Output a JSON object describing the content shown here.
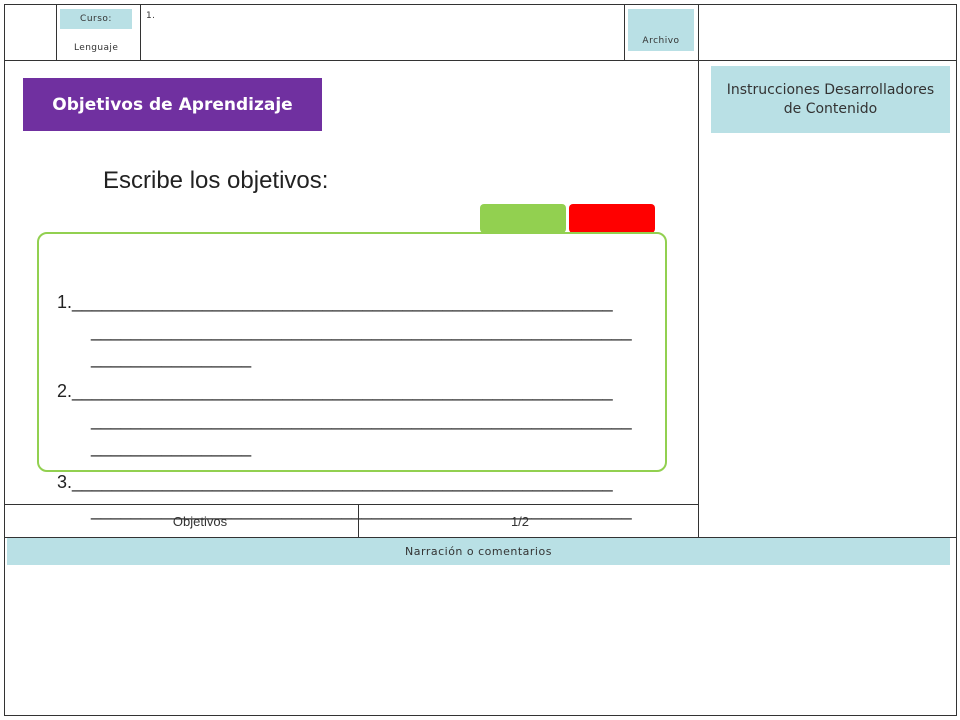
{
  "header": {
    "course_label": "Curso:",
    "course_value": "Lenguaje",
    "item_number": "1.",
    "file_label": "Archivo"
  },
  "section_title": "Objetivos de Aprendizaje",
  "instructions_label": "Instrucciones Desarrolladores de Contenido",
  "heading": "Escribe los objetivos:",
  "colors": {
    "accent_purple": "#7030a0",
    "green": "#92d050",
    "red": "#ff0000",
    "light_blue": "#b9e0e5"
  },
  "objectives": {
    "line1": "1.______________________________________________________",
    "line1_cont1": "______________________________________________________",
    "line1_cont2": "________________",
    "line2": "2.______________________________________________________",
    "line2_cont1": "______________________________________________________",
    "line2_cont2": "________________",
    "line3": "3.______________________________________________________",
    "line3_cont1": "______________________________________________________",
    "line3_cont2": "________________"
  },
  "footer": {
    "section": "Objetivos",
    "page": "1/2"
  },
  "narration_label": "Narración o comentarios"
}
